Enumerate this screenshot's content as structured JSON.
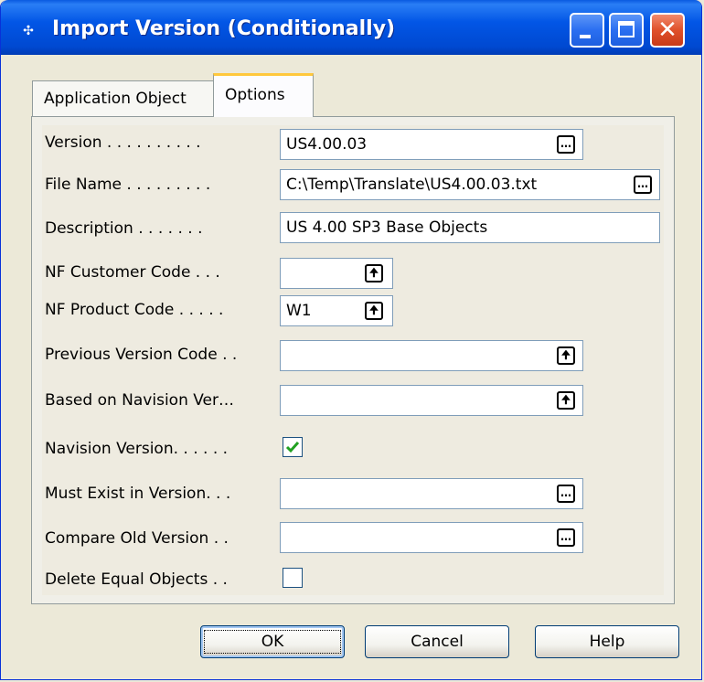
{
  "window": {
    "title": "Import Version (Conditionally)"
  },
  "tabs": [
    {
      "label": "Application Object"
    },
    {
      "label": "Options"
    }
  ],
  "fields": {
    "version": {
      "label": "Version . . . . . . . . . .",
      "value": "US4.00.03"
    },
    "file_name": {
      "label": "File Name . . . . . . . . .",
      "value": "C:\\Temp\\Translate\\US4.00.03.txt"
    },
    "description": {
      "label": "Description . . . . . . .",
      "value": "US 4.00 SP3 Base Objects"
    },
    "nf_customer_code": {
      "label": "NF Customer Code . . .",
      "value": ""
    },
    "nf_product_code": {
      "label": "NF Product Code . . . . .",
      "value": "W1"
    },
    "previous_version_code": {
      "label": "Previous Version Code . .",
      "value": ""
    },
    "based_on_navision": {
      "label": "Based on Navision Ver…",
      "value": ""
    },
    "navision_version": {
      "label": "Navision Version. . . . . .",
      "checked": true
    },
    "must_exist": {
      "label": "Must Exist in Version. . .",
      "value": ""
    },
    "compare_old": {
      "label": "Compare Old Version . .",
      "value": ""
    },
    "delete_equal": {
      "label": "Delete Equal Objects . .",
      "checked": false
    }
  },
  "buttons": {
    "ok": "OK",
    "cancel": "Cancel",
    "help": "Help"
  },
  "icons": {
    "lookup": "ellipsis-icon",
    "drilldown": "up-arrow-icon"
  },
  "colors": {
    "titlebar": "#0256e6",
    "tab_highlight": "#ffc83c",
    "check": "#21a121"
  }
}
